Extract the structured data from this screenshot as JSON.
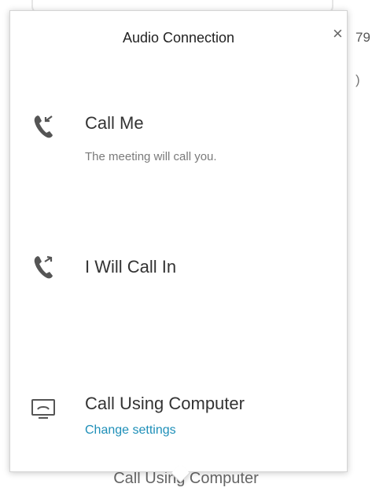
{
  "background": {
    "side_text": "79",
    "side_paren": ")",
    "bottom_text": "Call Using Computer"
  },
  "popover": {
    "title": "Audio Connection",
    "close_glyph": "×",
    "options": [
      {
        "id": "call-me",
        "label": "Call Me",
        "subtitle": "The meeting will call you.",
        "icon": "phone-incoming-icon"
      },
      {
        "id": "call-in",
        "label": "I Will Call In",
        "icon": "phone-outgoing-icon"
      },
      {
        "id": "computer",
        "label": "Call Using Computer",
        "link": "Change settings",
        "icon": "computer-audio-icon"
      }
    ]
  },
  "colors": {
    "accent_link": "#1e8fb8",
    "text": "#333333",
    "subtext": "#7a7a7a",
    "icon": "#555555"
  }
}
